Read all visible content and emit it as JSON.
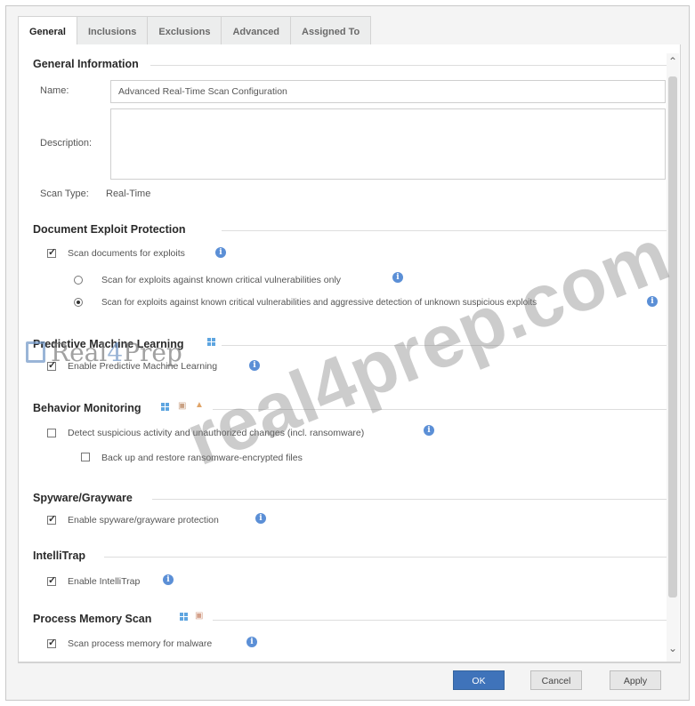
{
  "tabs": [
    "General",
    "Inclusions",
    "Exclusions",
    "Advanced",
    "Assigned To"
  ],
  "general_info": {
    "heading": "General Information",
    "name_label": "Name:",
    "name_value": "Advanced Real-Time Scan Configuration",
    "description_label": "Description:",
    "description_value": "",
    "scan_type_label": "Scan Type:",
    "scan_type_value": "Real-Time"
  },
  "doc_exploit": {
    "heading": "Document Exploit Protection",
    "scan_documents": {
      "label": "Scan documents for exploits",
      "checked": true
    },
    "radio_known": {
      "label": "Scan for exploits against known critical vulnerabilities only",
      "checked": false
    },
    "radio_aggressive": {
      "label": "Scan for exploits against known critical vulnerabilities and aggressive detection of unknown suspicious exploits",
      "checked": true
    }
  },
  "pml": {
    "heading": "Predictive Machine Learning",
    "enable": {
      "label": "Enable Predictive Machine Learning",
      "checked": true
    }
  },
  "behavior": {
    "heading": "Behavior Monitoring",
    "detect": {
      "label": "Detect suspicious activity and unauthorized changes (incl. ransomware)",
      "checked": false
    },
    "backup": {
      "label": "Back up and restore ransomware-encrypted files",
      "checked": false
    }
  },
  "spyware": {
    "heading": "Spyware/Grayware",
    "enable": {
      "label": "Enable spyware/grayware protection",
      "checked": true
    }
  },
  "intellitrap": {
    "heading": "IntelliTrap",
    "enable": {
      "label": "Enable IntelliTrap",
      "checked": true
    }
  },
  "memory_scan": {
    "heading": "Process Memory Scan",
    "enable": {
      "label": "Scan process memory for malware",
      "checked": true
    }
  },
  "footer": {
    "ok": "OK",
    "cancel": "Cancel",
    "apply": "Apply"
  },
  "watermark": {
    "logo_prefix": "Real",
    "logo_highlight": "4",
    "logo_suffix": "Prep",
    "diagonal": "real4prep.com"
  },
  "colors": {
    "primary_button": "#3f73ba",
    "info_icon": "#5b8fd6",
    "windows_icon": "#5ea5e0"
  }
}
